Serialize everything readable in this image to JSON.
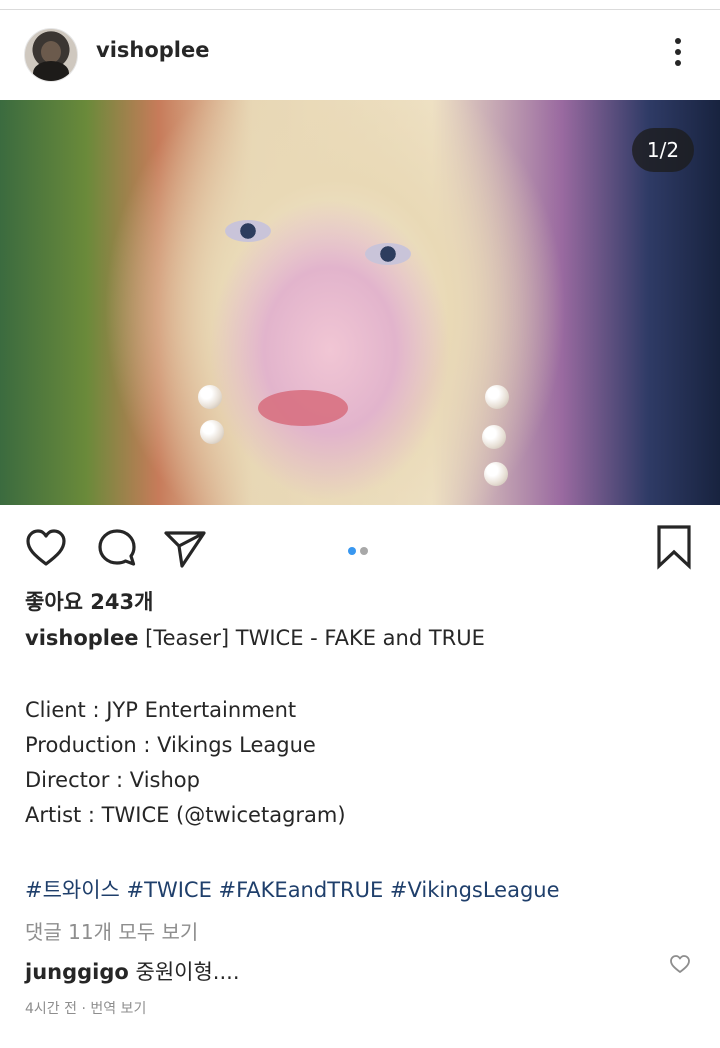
{
  "post": {
    "username": "vishoplee",
    "image_counter": "1/2",
    "carousel": {
      "count": 2,
      "active": 0
    },
    "likes": "좋아요 243개",
    "caption": {
      "author": "vishoplee",
      "title": "[Teaser] TWICE - FAKE and TRUE",
      "lines": [
        "Client : JYP Entertainment",
        "Production : Vikings League",
        "Director : Vishop",
        "Artist : TWICE (@twicetagram)"
      ],
      "hashtags": "#트와이스 #TWICE #FAKEandTRUE #VikingsLeague"
    },
    "view_comments": "댓글 11개 모두 보기",
    "comment": {
      "author": "junggigo",
      "text": "중원이형...."
    },
    "meta": "4시간 전 · 번역 보기"
  },
  "icons": {
    "more": "more-options-icon",
    "like": "heart-icon",
    "comment": "comment-bubble-icon",
    "share": "paper-plane-icon",
    "save": "bookmark-icon",
    "comment_like": "small-heart-icon"
  },
  "colors": {
    "text": "#262626",
    "hashtag": "#1f3f6b",
    "muted": "#8e8e8e",
    "dot_active": "#3897f0",
    "dot_inactive": "#a8a8a8"
  }
}
